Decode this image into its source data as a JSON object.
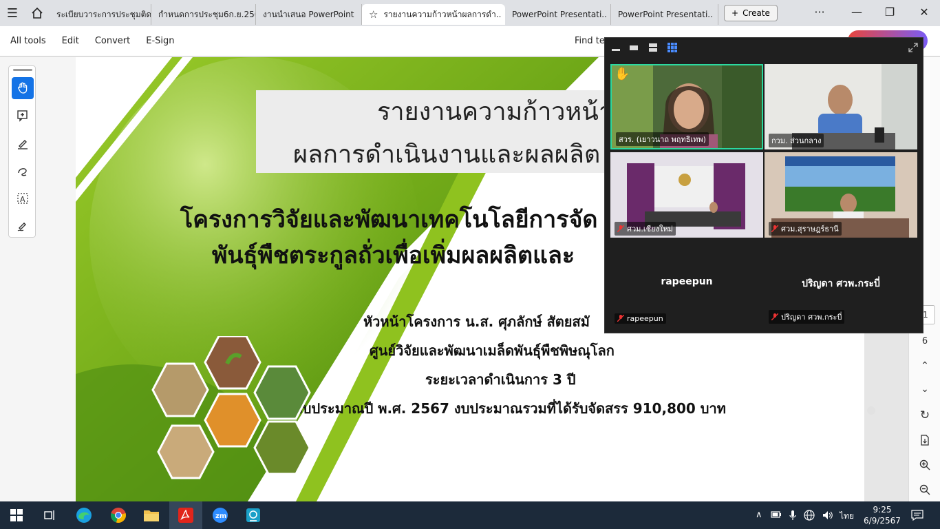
{
  "browser": {
    "tabs": [
      {
        "label": "ระเบียบวาระการประชุมติดตา..",
        "active": false
      },
      {
        "label": "กำหนดการประชุม6ก.ย.256..",
        "active": false
      },
      {
        "label": "งานนำเสนอ PowerPoint",
        "active": false
      },
      {
        "label": "รายงานความก้าวหน้าผลการดำ..",
        "active": true
      },
      {
        "label": "PowerPoint Presentati..",
        "active": false
      },
      {
        "label": "PowerPoint Presentati..",
        "active": false
      }
    ],
    "create_label": "Create"
  },
  "menu": {
    "all_tools": "All tools",
    "edit": "Edit",
    "convert": "Convert",
    "esign": "E-Sign",
    "find_text": "Find tex"
  },
  "slide": {
    "title_line1": "รายงานความก้าวหน้า",
    "title_line2": "ผลการดำเนินงานและผลผลิต",
    "project_line1": "โครงการวิจัยและพัฒนาเทคโนโลยีการจัด",
    "project_line2": "พันธุ์พืชตระกูลถั่วเพื่อเพิ่มผลผลิตและ",
    "leader": "หัวหน้าโครงการ น.ส. ศุภลักษ์ สัตยสมั",
    "center": "ศูนย์วิจัยและพัฒนาเมล็ดพันธุ์พืชพิษณุโลก",
    "duration": "ระยะเวลาดำเนินการ 3 ปี",
    "budget": "งบประมาณปี พ.ศ. 2567   งบประมาณรวมที่ได้รับจัดสรร 910,800 บาท"
  },
  "right_rail": {
    "page_partial": "1",
    "page_count": "6"
  },
  "zoom": {
    "participants": [
      {
        "name": "สวร. (เยาวนาถ พฤทธิเทพ)",
        "muted": false
      },
      {
        "name": "กวม. ส่วนกลาง",
        "muted": false
      },
      {
        "name": "ศวม.เชียงใหม่",
        "muted": true
      },
      {
        "name": "ศวม.สุราษฎร์ธานี",
        "muted": true
      },
      {
        "name": "rapeepun",
        "big": "rapeepun",
        "muted": true
      },
      {
        "name": "ปริญดา ศวพ.กระบี่",
        "big": "ปริญดา ศวพ.กระบี่",
        "muted": true
      }
    ],
    "accent": "#2bd9a0"
  },
  "taskbar": {
    "lang": "ไทย",
    "time": "9:25",
    "date": "6/9/2567"
  }
}
